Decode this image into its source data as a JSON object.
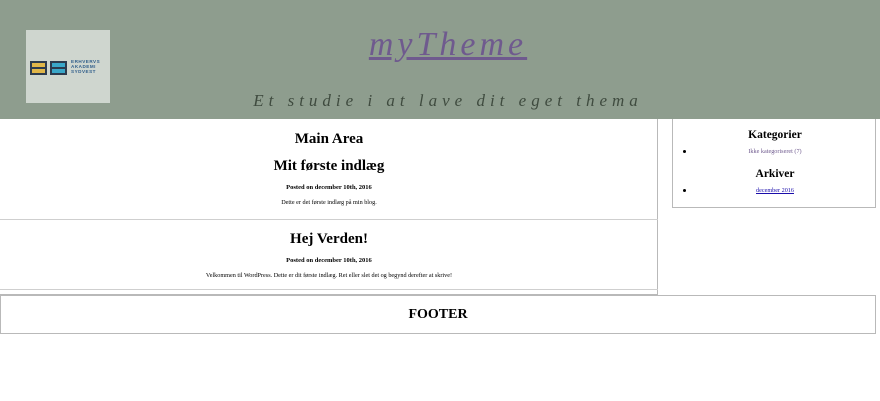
{
  "header": {
    "logo_text": [
      "ERHVERVS",
      "AKADEMI",
      "SYDVEST"
    ],
    "site_title": "myTheme",
    "tagline": "Et studie i at lave dit eget thema",
    "colors": {
      "background": "#8e9d8e",
      "title": "#6f5a8e"
    }
  },
  "main": {
    "title": "Main Area",
    "posts": [
      {
        "title": "Mit første indlæg",
        "meta": "Posted on december 10th, 2016",
        "excerpt": "Dette er det første indlæg på min blog."
      },
      {
        "title": "Hej Verden!",
        "meta": "Posted on december 10th, 2016",
        "excerpt": "Velkommen til WordPress. Dette er dit første indlæg. Ret eller slet det og begynd derefter at skrive!"
      }
    ]
  },
  "sidebar": {
    "categories_title": "Kategorier",
    "categories": [
      "Ikke kategoriseret (7)"
    ],
    "archives_title": "Arkiver",
    "archives": [
      "december 2016"
    ]
  },
  "footer": {
    "label": "FOOTER"
  }
}
